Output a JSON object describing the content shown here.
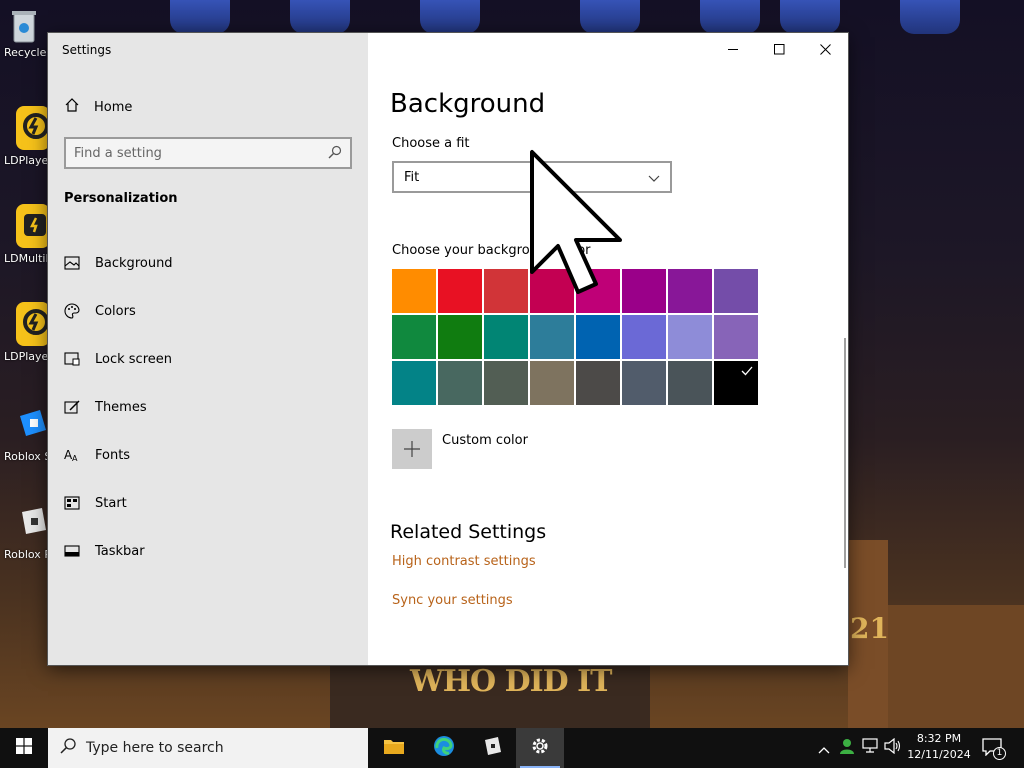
{
  "window": {
    "title": "Settings",
    "controls": {
      "minimize": "—",
      "maximize": "☐",
      "close": "✕"
    }
  },
  "sidebar": {
    "home_label": "Home",
    "search_placeholder": "Find a setting",
    "section_title": "Personalization",
    "items": [
      {
        "label": "Background",
        "icon": "image-icon"
      },
      {
        "label": "Colors",
        "icon": "palette-icon"
      },
      {
        "label": "Lock screen",
        "icon": "lock-screen-icon"
      },
      {
        "label": "Themes",
        "icon": "themes-icon"
      },
      {
        "label": "Fonts",
        "icon": "fonts-icon"
      },
      {
        "label": "Start",
        "icon": "start-icon"
      },
      {
        "label": "Taskbar",
        "icon": "taskbar-icon"
      }
    ]
  },
  "content": {
    "page_title": "Background",
    "fit_label": "Choose a fit",
    "fit_value": "Fit",
    "bg_color_label": "Choose your background color",
    "swatches": [
      "#FF8C00",
      "#E81123",
      "#D13438",
      "#C30052",
      "#BF0077",
      "#9A0089",
      "#881798",
      "#744DA9",
      "#10893E",
      "#107C10",
      "#018574",
      "#2D7D9A",
      "#0063B1",
      "#6B69D6",
      "#8E8CD8",
      "#8764B8",
      "#038387",
      "#486860",
      "#525E54",
      "#7E735F",
      "#4C4A48",
      "#515C6B",
      "#4A5459",
      "#000000"
    ],
    "selected_swatch": 23,
    "custom_color_label": "Custom color",
    "related_title": "Related Settings",
    "related_links": [
      "High contrast settings",
      "Sync your settings"
    ],
    "link_color": "#B8631A"
  },
  "desktop": {
    "icons": [
      {
        "label": "Recycle Bin",
        "icon": "recycle-bin-icon"
      },
      {
        "label": "LDPlayer",
        "icon": "ldplayer-icon"
      },
      {
        "label": "LDMultiPlayer",
        "icon": "ldmultiplayer-icon"
      },
      {
        "label": "LDPlayer",
        "icon": "ldplayer-icon"
      },
      {
        "label": "Roblox Studio",
        "icon": "roblox-studio-icon"
      },
      {
        "label": "Roblox Player",
        "icon": "roblox-player-icon"
      }
    ],
    "wallpaper_text": "WHO DID IT",
    "wallpaper_number": "21"
  },
  "taskbar": {
    "search_placeholder": "Type here to search",
    "apps": [
      "file-explorer-icon",
      "edge-icon",
      "roblox-icon",
      "settings-icon"
    ],
    "time": "8:32 PM",
    "date": "12/11/2024",
    "notification_count": "1"
  }
}
